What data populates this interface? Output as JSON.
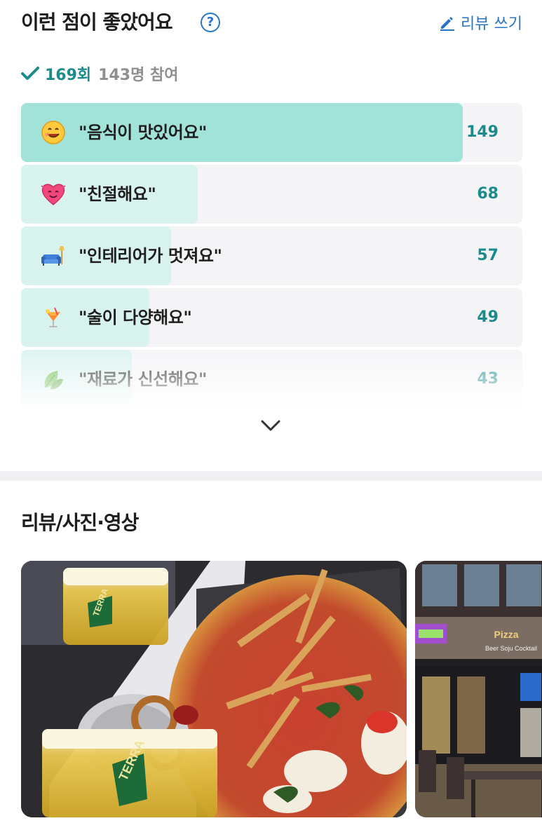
{
  "header": {
    "title": "이런 점이 좋았어요",
    "help_icon": "?",
    "write_label": "리뷰 쓰기"
  },
  "summary": {
    "count": "169회",
    "participants": "143명 참여"
  },
  "keywords": [
    {
      "icon": "smiling-face-icon",
      "label": "\"음식이 맛있어요\"",
      "count": "149",
      "fraction": 1.0,
      "fill": "#a1e2d9"
    },
    {
      "icon": "heart-face-icon",
      "label": "\"친절해요\"",
      "count": "68",
      "fraction": 0.4,
      "fill": "#d8f2ee"
    },
    {
      "icon": "sofa-icon",
      "label": "\"인테리어가 멋져요\"",
      "count": "57",
      "fraction": 0.34,
      "fill": "#d8f2ee"
    },
    {
      "icon": "cocktail-icon",
      "label": "\"술이 다양해요\"",
      "count": "49",
      "fraction": 0.29,
      "fill": "#d8f2ee"
    },
    {
      "icon": "leaf-icon",
      "label": "\"재료가 신선해요\"",
      "count": "43",
      "fraction": 0.25,
      "fill": "#d8f2ee"
    }
  ],
  "section": {
    "title": "리뷰/사진·영상"
  },
  "photos": [
    {
      "name": "review-photo-pizza",
      "signs": [
        "TERRA",
        "TERRA"
      ]
    },
    {
      "name": "review-photo-storefront",
      "signs": [
        "Beer Soju Cocktail"
      ]
    }
  ],
  "colors": {
    "accent": "#1c8b8c",
    "link": "#2a74c6",
    "bar_bg": "#f4f4f7"
  }
}
